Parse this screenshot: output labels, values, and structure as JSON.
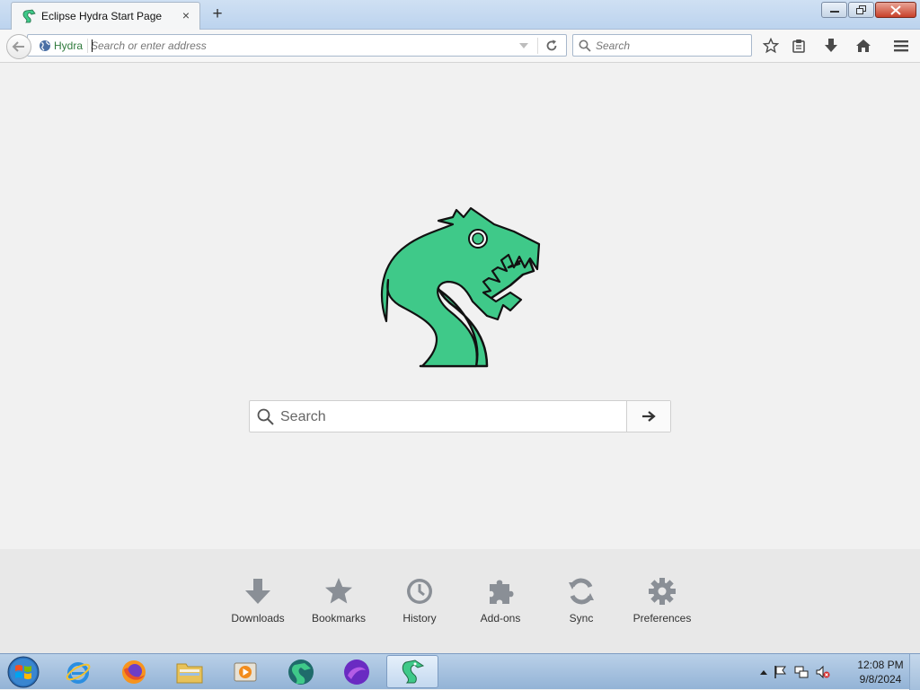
{
  "browser": {
    "tab": {
      "title": "Eclipse Hydra Start Page",
      "close_label": "×"
    },
    "new_tab_label": "+",
    "window_controls": [
      "minimize",
      "maximize",
      "close"
    ]
  },
  "navbar": {
    "identity_label": "Hydra",
    "url_placeholder": "Search or enter address",
    "url_value": "",
    "search_placeholder": "Search"
  },
  "content": {
    "search_placeholder": "Search"
  },
  "launcher": {
    "items": [
      {
        "label": "Downloads",
        "icon": "download-icon"
      },
      {
        "label": "Bookmarks",
        "icon": "star-icon"
      },
      {
        "label": "History",
        "icon": "clock-icon"
      },
      {
        "label": "Add-ons",
        "icon": "puzzle-icon"
      },
      {
        "label": "Sync",
        "icon": "sync-icon"
      },
      {
        "label": "Preferences",
        "icon": "gear-icon"
      }
    ]
  },
  "taskbar": {
    "apps": [
      "internet-explorer",
      "firefox",
      "file-explorer",
      "media-player",
      "hydra-browser-alt",
      "purple-browser",
      "eclipse-hydra"
    ],
    "clock": {
      "time": "12:08 PM",
      "date": "9/8/2024"
    }
  },
  "colors": {
    "brand_green": "#3fc989",
    "titlebar": "#c4d8f0",
    "taskbar": "#a8c3e0"
  }
}
